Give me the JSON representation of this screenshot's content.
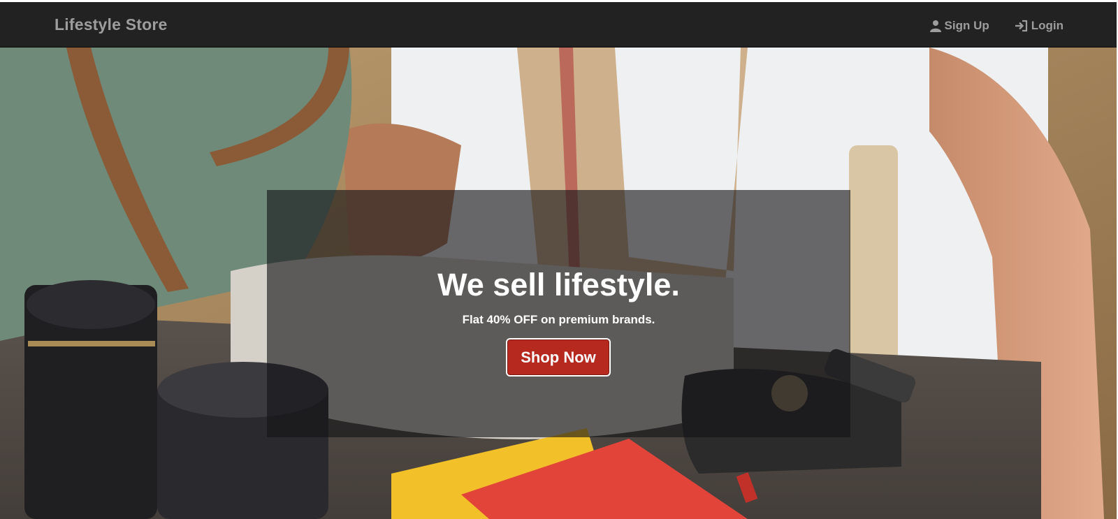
{
  "navbar": {
    "brand": "Lifestyle Store",
    "links": [
      {
        "label": "Sign Up",
        "icon": "user-icon"
      },
      {
        "label": "Login",
        "icon": "login-icon"
      }
    ]
  },
  "hero": {
    "title": "We sell lifestyle.",
    "subtitle": "Flat 40% OFF on premium brands.",
    "cta_label": "Shop Now"
  },
  "colors": {
    "navbar_bg": "#222222",
    "nav_text": "#9d9d9d",
    "cta_bg": "#b5291f",
    "overlay": "rgba(20,20,22,0.62)"
  }
}
